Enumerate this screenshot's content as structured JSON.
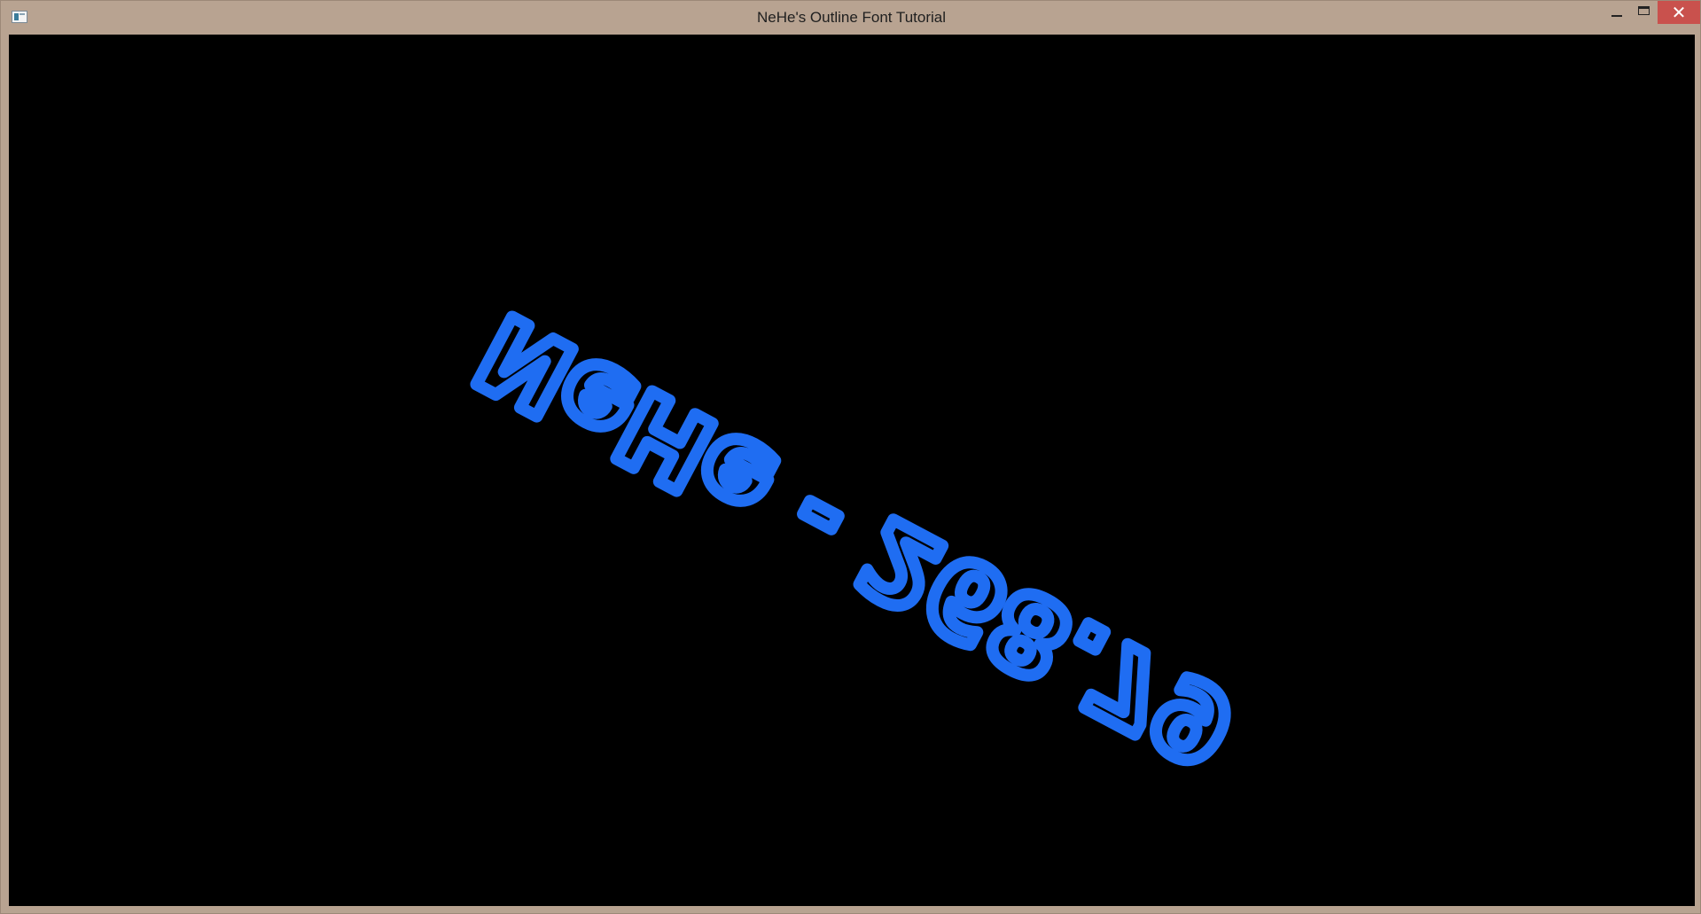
{
  "window": {
    "title": "NeHe's Outline Font Tutorial"
  },
  "controls": {
    "minimize_icon": "minimize-icon",
    "maximize_icon": "maximize-icon",
    "close_icon": "close-icon",
    "close_glyph": "✕"
  },
  "scene": {
    "rendered_text": "NeHe - 268.79",
    "text_color": "#1f6df2",
    "background_color": "#000000"
  }
}
